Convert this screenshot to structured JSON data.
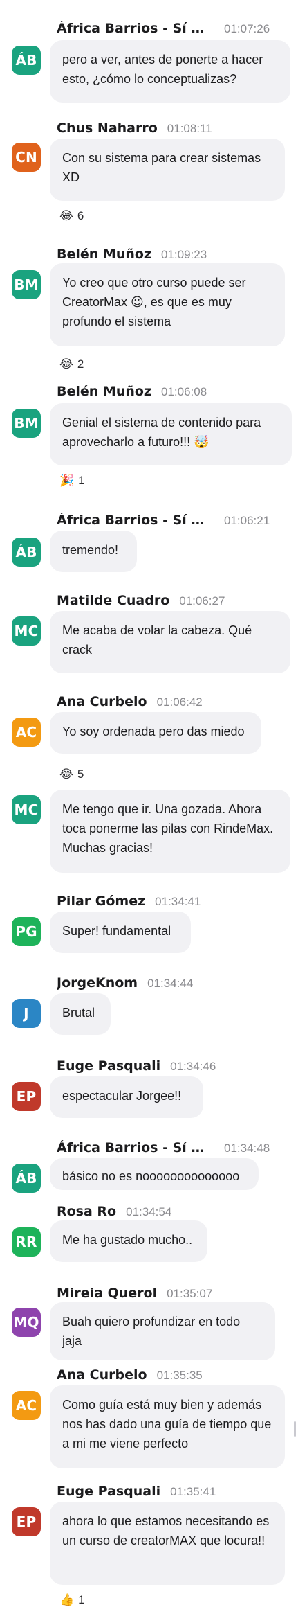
{
  "messages": [
    {
      "initials": "ÁB",
      "color": "#1aa37f",
      "author": "África Barrios - Sí Quiero Vivir de Mi Pasión",
      "time": "01:07:26",
      "text": "pero a ver, antes de ponerte a hacer esto, ¿cómo lo conceptualizas?",
      "reaction": null
    },
    {
      "initials": "CN",
      "color": "#e0621c",
      "author": "Chus Naharro",
      "time": "01:08:11",
      "text": "Con su sistema para crear sistemas XD",
      "reaction": {
        "emoji": "😂",
        "count": "6"
      }
    },
    {
      "initials": "BM",
      "color": "#1aa37f",
      "author": "Belén Muñoz",
      "time": "01:09:23",
      "text": "Yo creo que otro curso puede ser CreatorMax 😉, es que es muy profundo el sistema",
      "reaction": {
        "emoji": "😂",
        "count": "2"
      }
    },
    {
      "initials": "BM",
      "color": "#1aa37f",
      "author": "Belén Muñoz",
      "time": "01:06:08",
      "text": "Genial el sistema de contenido para aprovecharlo a futuro!!! 🤯",
      "reaction": {
        "emoji": "🎉",
        "count": "1"
      }
    },
    {
      "initials": "ÁB",
      "color": "#1aa37f",
      "author": "África Barrios - Sí Quiero Vivir de Mi Pasión",
      "time": "01:06:21",
      "text": "tremendo!",
      "reaction": null
    },
    {
      "initials": "MC",
      "color": "#1aa37f",
      "author": "Matilde Cuadro",
      "time": "01:06:27",
      "text": "Me acaba de volar la cabeza. Qué crack",
      "reaction": null
    },
    {
      "initials": "AC",
      "color": "#f39a12",
      "author": "Ana Curbelo",
      "time": "01:06:42",
      "text": "Yo soy ordenada pero das miedo",
      "reaction": {
        "emoji": "😂",
        "count": "5"
      }
    },
    {
      "initials": "MC",
      "color": "#1aa37f",
      "author": "",
      "time": "",
      "text": "Me tengo que ir. Una gozada. Ahora toca ponerme las pilas con RindeMax. Muchas gracias!",
      "reaction": null
    },
    {
      "initials": "PG",
      "color": "#1eb35a",
      "author": "Pilar Gómez",
      "time": "01:34:41",
      "text": "Super! fundamental",
      "reaction": null
    },
    {
      "initials": "J",
      "color": "#2b86c5",
      "author": "JorgeKnom",
      "time": "01:34:44",
      "text": "Brutal",
      "reaction": null
    },
    {
      "initials": "EP",
      "color": "#c0392b",
      "author": "Euge Pasquali",
      "time": "01:34:46",
      "text": "espectacular Jorgee!!",
      "reaction": null
    },
    {
      "initials": "ÁB",
      "color": "#1aa37f",
      "author": "África Barrios - Sí Quiero Vivir de Mi Pasión",
      "time": "01:34:48",
      "text": "básico no es noooooooooooooo",
      "reaction": null
    },
    {
      "initials": "RR",
      "color": "#1eb35a",
      "author": "Rosa Ro",
      "time": "01:34:54",
      "text": "Me ha gustado mucho..",
      "reaction": null
    },
    {
      "initials": "MQ",
      "color": "#8e44ad",
      "author": "Mireia Querol",
      "time": "01:35:07",
      "text": "Buah quiero profundizar en todo jaja",
      "reaction": null
    },
    {
      "initials": "AC",
      "color": "#f39a12",
      "author": "Ana Curbelo",
      "time": "01:35:35",
      "text": "Como guía está muy bien y además nos has dado una guía de tiempo que a mi me viene perfecto",
      "reaction": null
    },
    {
      "initials": "EP",
      "color": "#c0392b",
      "author": "Euge Pasquali",
      "time": "01:35:41",
      "text": "ahora lo que estamos necesitando es un curso de creatorMAX que locura!!",
      "reaction": {
        "emoji": "👍",
        "count": "1"
      }
    }
  ]
}
